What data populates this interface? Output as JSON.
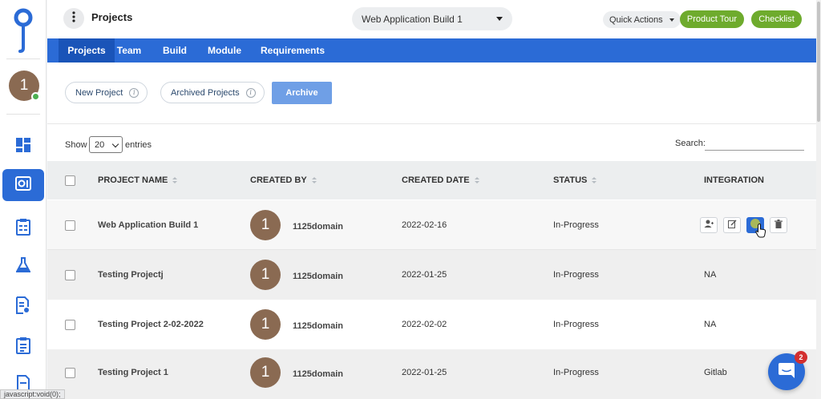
{
  "header": {
    "title": "Projects",
    "project_select": "Web Application Build 1",
    "quick_actions": "Quick Actions",
    "product_tour": "Product Tour",
    "checklist": "Checklist"
  },
  "sidebar": {
    "avatar_initial": "1",
    "items": [
      {
        "icon": "dashboard-icon"
      },
      {
        "icon": "projects-icon",
        "active": true
      },
      {
        "icon": "test-plan-icon"
      },
      {
        "icon": "lab-flask-icon"
      },
      {
        "icon": "document-gear-icon"
      },
      {
        "icon": "clipboard-list-icon"
      },
      {
        "icon": "report-icon"
      }
    ]
  },
  "tabs": [
    {
      "label": "Projects",
      "active": true
    },
    {
      "label": "Team"
    },
    {
      "label": "Build"
    },
    {
      "label": "Module"
    },
    {
      "label": "Requirements"
    }
  ],
  "toolbar": {
    "new_project": "New Project",
    "archived_projects": "Archived Projects",
    "archive": "Archive",
    "info_glyph": "i"
  },
  "table_controls": {
    "show_label": "Show",
    "entries_value": "20",
    "entries_label": "entries",
    "search_label": "Search:",
    "search_value": ""
  },
  "table": {
    "columns": [
      "PROJECT NAME",
      "CREATED BY",
      "CREATED DATE",
      "STATUS",
      "INTEGRATION"
    ],
    "rows": [
      {
        "name": "Web Application Build 1",
        "avatar": "1",
        "created_by": "1125domain",
        "date": "2022-02-16",
        "status": "In-Progress",
        "integration": ""
      },
      {
        "name": "Testing Projectj",
        "avatar": "1",
        "created_by": "1125domain",
        "date": "2022-01-25",
        "status": "In-Progress",
        "integration": "NA"
      },
      {
        "name": "Testing Project 2-02-2022",
        "avatar": "1",
        "created_by": "1125domain",
        "date": "2022-02-02",
        "status": "In-Progress",
        "integration": "NA"
      },
      {
        "name": "Testing Project 1",
        "avatar": "1",
        "created_by": "1125domain",
        "date": "2022-01-25",
        "status": "In-Progress",
        "integration": "Gitlab"
      }
    ]
  },
  "chat": {
    "badge": "2"
  },
  "statusbar": {
    "text": "javascript:void(0);"
  },
  "colors": {
    "primary": "#2b6bd6",
    "tab_active": "#1a54b8",
    "green": "#6eab2d",
    "avatar": "#8a6a52",
    "row_alt": "#efefef",
    "row_hover": "#f7f7f7"
  }
}
